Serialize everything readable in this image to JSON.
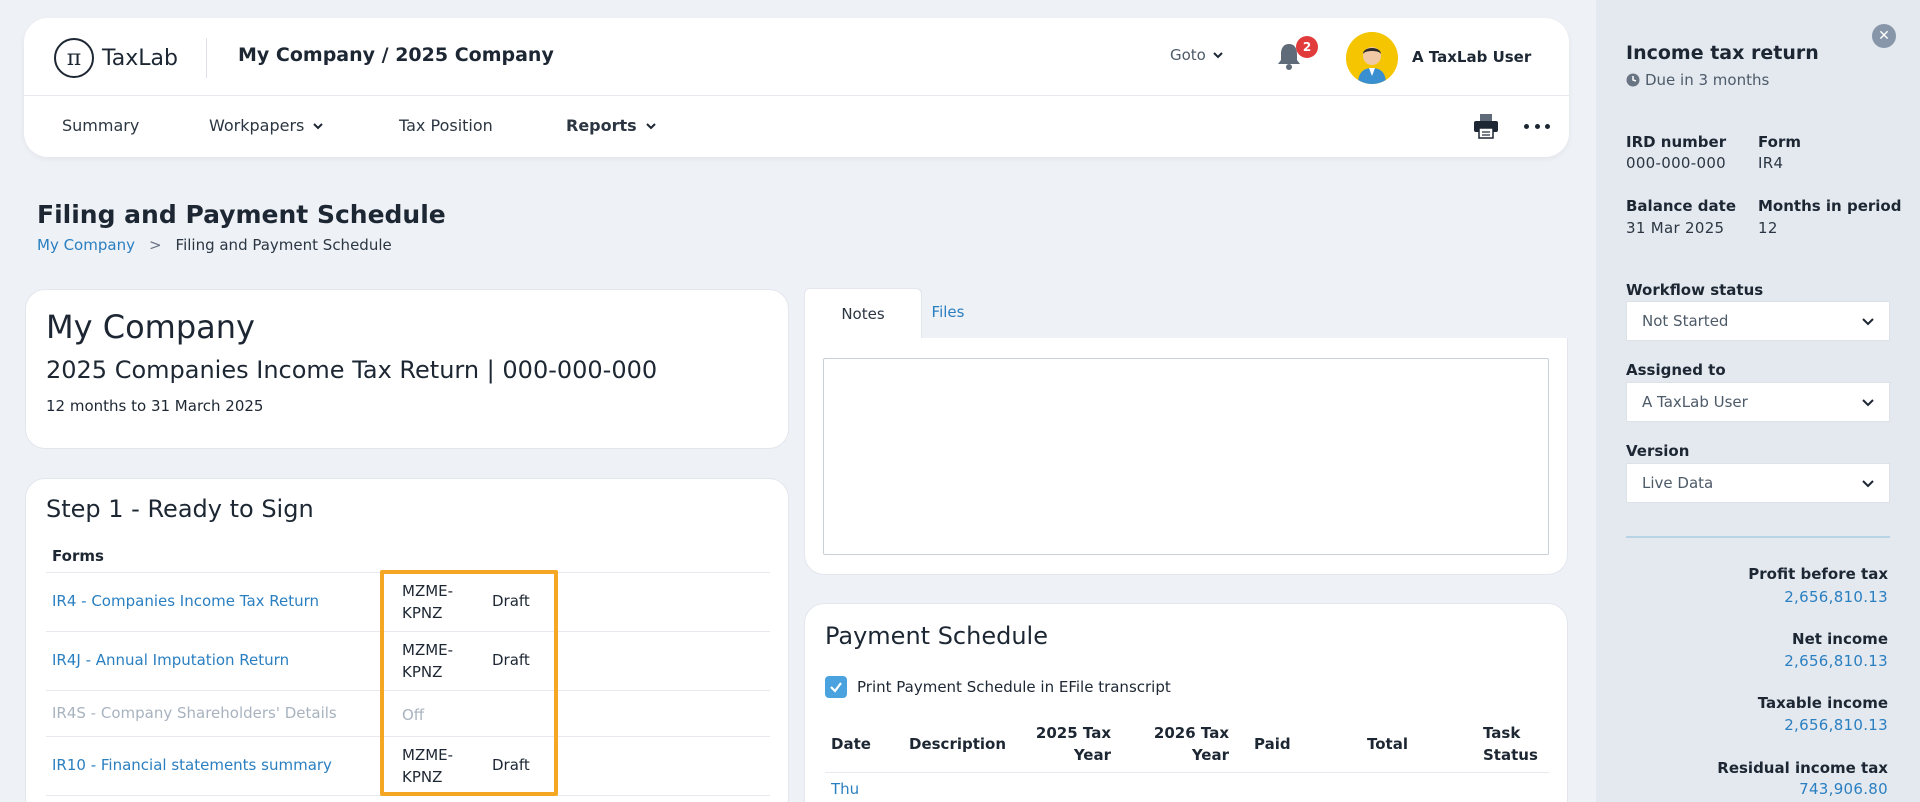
{
  "header": {
    "logo_glyph": "π",
    "logo_text": "TaxLab",
    "company_title": "My Company / 2025 Company",
    "goto_label": "Goto",
    "notification_count": "2",
    "user_name": "A TaxLab User"
  },
  "nav": {
    "items": [
      {
        "label": "Summary"
      },
      {
        "label": "Workpapers"
      },
      {
        "label": "Tax Position"
      },
      {
        "label": "Reports"
      }
    ]
  },
  "page": {
    "title": "Filing and Payment Schedule",
    "breadcrumb": {
      "root": "My Company",
      "separator": ">",
      "current": "Filing and Payment Schedule"
    }
  },
  "company_card": {
    "name": "My Company",
    "subtitle": "2025 Companies Income Tax Return | 000-000-000",
    "period": "12 months to 31 March 2025"
  },
  "step1": {
    "title": "Step 1 - Ready to Sign",
    "forms_header": "Forms",
    "forms": [
      {
        "name": "IR4  -  Companies Income Tax Return",
        "code_line1": "MZME-",
        "code_line2": "KPNZ",
        "status": "Draft"
      },
      {
        "name": "IR4J  -  Annual Imputation Return",
        "code_line1": "MZME-",
        "code_line2": "KPNZ",
        "status": "Draft"
      },
      {
        "name": "IR4S  -  Company Shareholders' Details",
        "code_line1": "",
        "code_line2": "",
        "status": "Off"
      },
      {
        "name": "IR10  -  Financial statements summary",
        "code_line1": "MZME-",
        "code_line2": "KPNZ",
        "status": "Draft"
      }
    ]
  },
  "notes": {
    "tabs": [
      {
        "label": "Notes"
      },
      {
        "label": "Files"
      }
    ],
    "textarea_value": ""
  },
  "payment": {
    "title": "Payment Schedule",
    "checkbox_label": "Print Payment Schedule in EFile transcript",
    "checkbox_checked": true,
    "columns": {
      "date": "Date",
      "description": "Description",
      "tax2025_l1": "2025 Tax",
      "tax2025_l2": "Year",
      "tax2026_l1": "2026 Tax",
      "tax2026_l2": "Year",
      "paid": "Paid",
      "total": "Total",
      "task_l1": "Task",
      "task_l2": "Status"
    },
    "first_row_date": "Thu"
  },
  "side_panel": {
    "title": "Income tax return",
    "due": "Due in 3 months",
    "ird_label": "IRD number",
    "ird_value": "000-000-000",
    "form_label": "Form",
    "form_value": "IR4",
    "balance_label": "Balance date",
    "balance_value": "31 Mar 2025",
    "months_label": "Months in period",
    "months_value": "12",
    "workflow_label": "Workflow status",
    "workflow_value": "Not Started",
    "assigned_label": "Assigned to",
    "assigned_value": "A TaxLab User",
    "version_label": "Version",
    "version_value": "Live Data",
    "metrics": [
      {
        "label": "Profit before tax",
        "value": "2,656,810.13"
      },
      {
        "label": "Net income",
        "value": "2,656,810.13"
      },
      {
        "label": "Taxable income",
        "value": "2,656,810.13"
      },
      {
        "label": "Residual income tax",
        "value": "743,906.80"
      }
    ]
  },
  "colors": {
    "accent": "#2a7fc1",
    "highlight": "#f5a623",
    "badge": "#e23b3b",
    "checkbox": "#4aa3df"
  }
}
